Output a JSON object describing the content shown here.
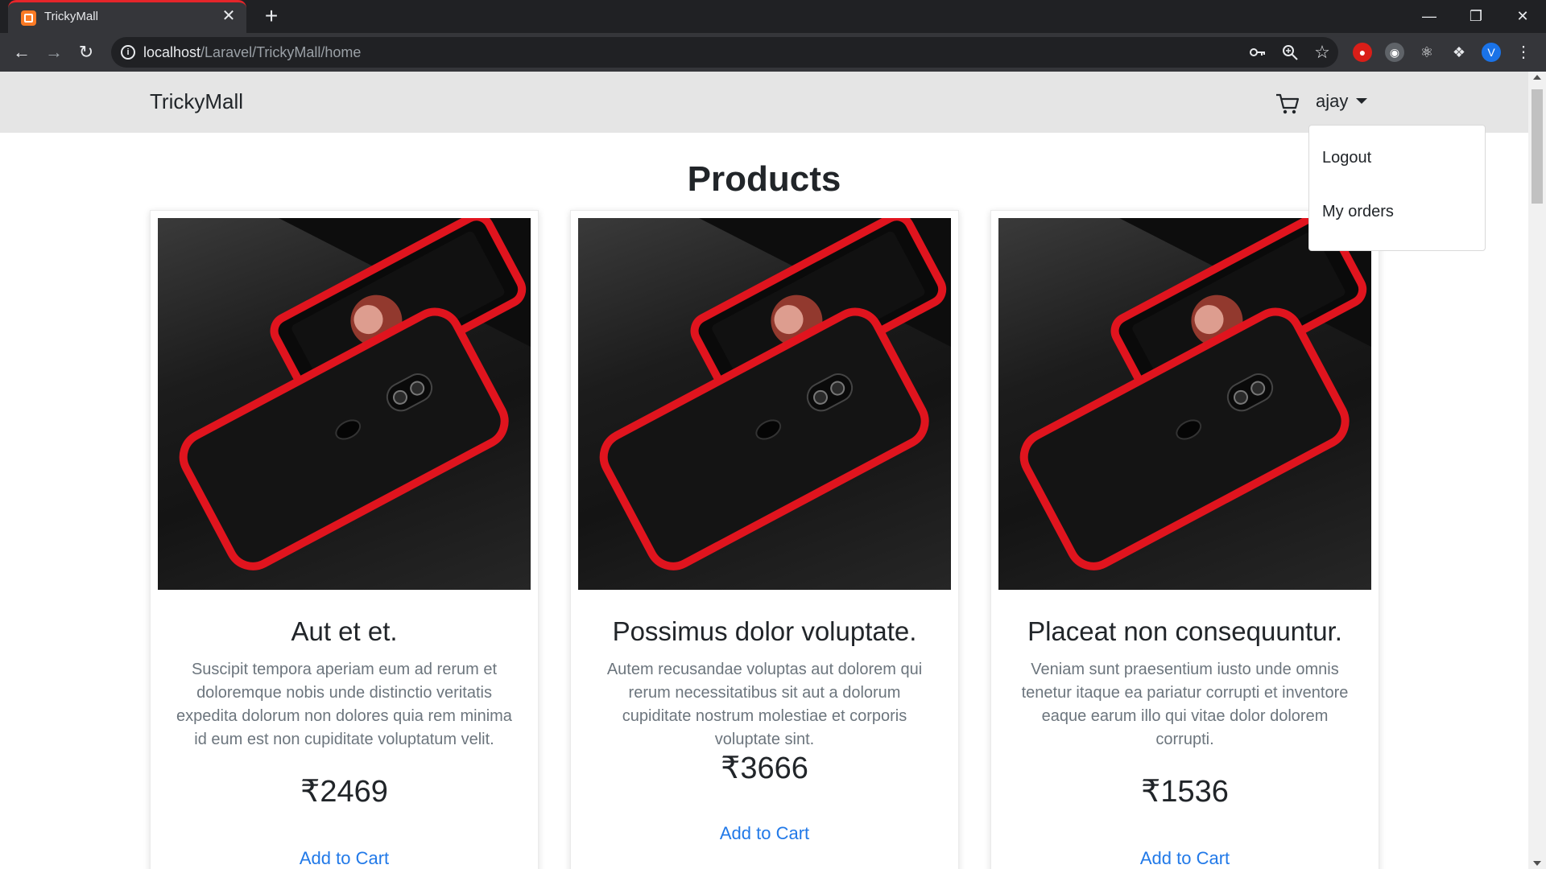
{
  "browser": {
    "tab_title": "TrickyMall",
    "tab_close": "✕",
    "new_tab": "+",
    "url_host": "localhost",
    "url_path": "/Laravel/TrickyMall/home",
    "profile_initial": "V"
  },
  "navbar": {
    "brand": "TrickyMall",
    "user": "ajay"
  },
  "dropdown": {
    "items": [
      "Logout",
      "My orders"
    ]
  },
  "page": {
    "title": "Products",
    "currency_symbol": "₹"
  },
  "products": [
    {
      "title": "Aut et et.",
      "description": "Suscipit tempora aperiam eum ad rerum et doloremque nobis unde distinctio veritatis expedita dolorum non dolores quia rem minima id eum est non cupiditate voluptatum velit.",
      "price": "2469",
      "cta": "Add to Cart"
    },
    {
      "title": "Possimus dolor voluptate.",
      "description": "Autem recusandae voluptas aut dolorem qui rerum necessitatibus sit aut a dolorum cupiditate nostrum molestiae et corporis voluptate sint.",
      "price": "3666",
      "cta": "Add to Cart"
    },
    {
      "title": "Placeat non consequuntur.",
      "description": "Veniam sunt praesentium iusto unde omnis tenetur itaque ea pariatur corrupti et inventore eaque earum illo qui vitae dolor dolorem corrupti.",
      "price": "1536",
      "cta": "Add to Cart"
    }
  ],
  "colors": {
    "navbar_bg": "#e5e5e5",
    "link_blue": "#2179e8",
    "phone_red": "#e0141e"
  }
}
